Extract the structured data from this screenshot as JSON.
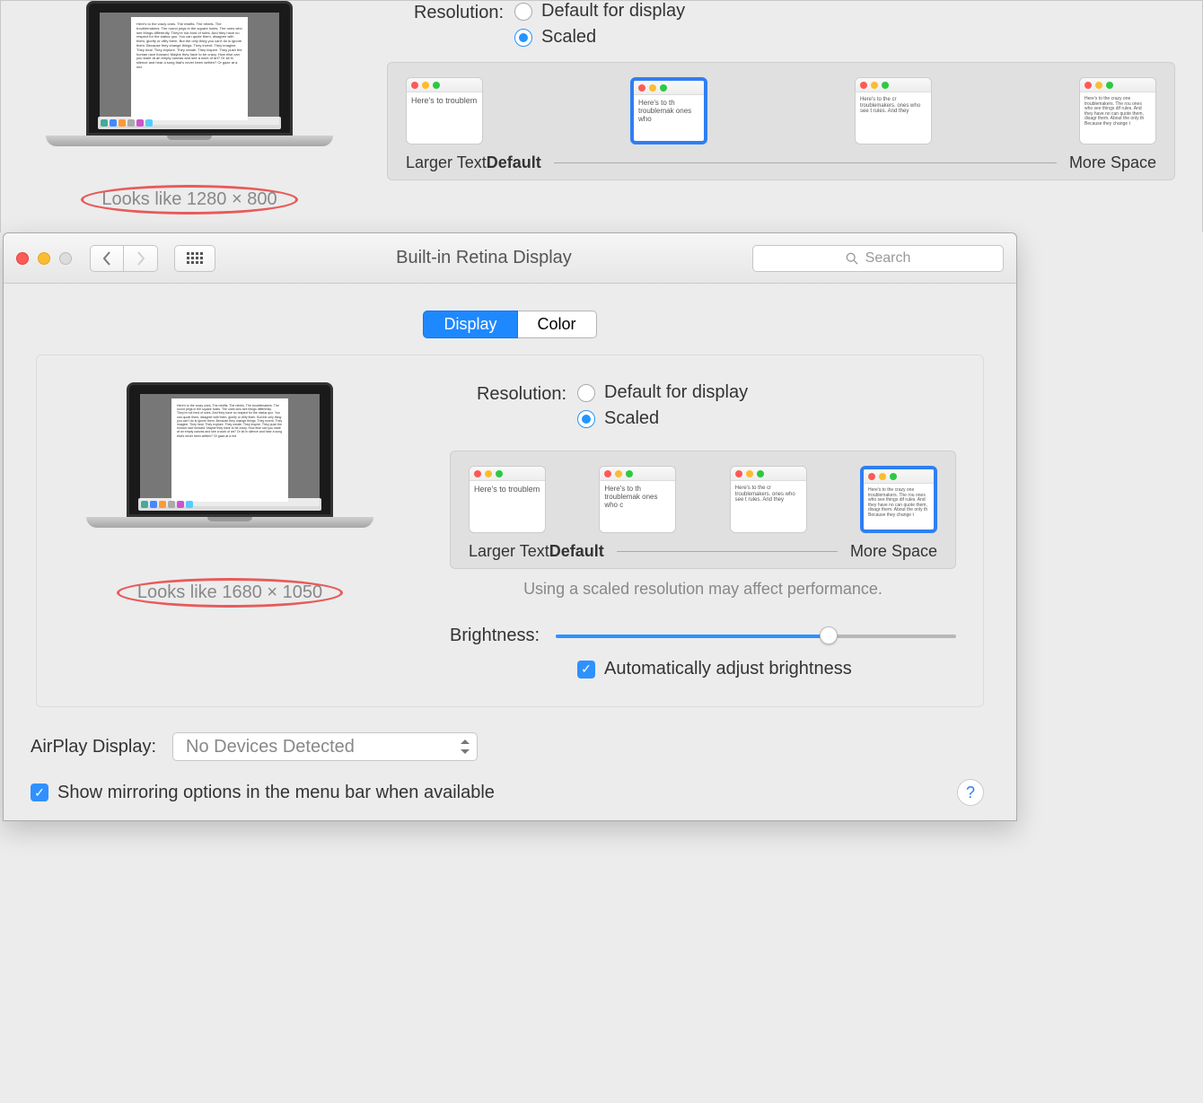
{
  "top": {
    "resolution_label": "Resolution:",
    "radio_default": "Default for display",
    "radio_scaled": "Scaled",
    "annotation": "Looks like 1280 × 800",
    "scale_labels": {
      "larger": "Larger Text",
      "default": "Default",
      "more": "More Space"
    },
    "sample_large": "Here's to troublem",
    "sample_default": "Here's to th troublemak ones who",
    "sample_mid": "Here's to the cr troublemakers. ones who see t rules. And they",
    "sample_small": "Here's to the crazy one troublemakers. The rou ones who see things dif rules. And they have no can quote them, disagr them. About the only th Because they change t"
  },
  "window": {
    "title": "Built-in Retina Display",
    "search_placeholder": "Search",
    "tabs": {
      "display": "Display",
      "color": "Color"
    },
    "resolution_label": "Resolution:",
    "radio_default": "Default for display",
    "radio_scaled": "Scaled",
    "annotation": "Looks like 1680 × 1050",
    "scale_labels": {
      "larger": "Larger Text",
      "default": "Default",
      "more": "More Space"
    },
    "sample_large": "Here's to troublem",
    "sample_default": "Here's to th troublemak ones who c",
    "sample_mid": "Here's to the cr troublemakers. ones who see t rules. And they",
    "sample_small": "Here's to the crazy one troublemakers. The rou ones who see things dif rules. And they have no can quote them, disagr them. About the only th Because they change t",
    "warning": "Using a scaled resolution may affect performance.",
    "brightness_label": "Brightness:",
    "auto_brightness": "Automatically adjust brightness",
    "airplay_label": "AirPlay Display:",
    "airplay_value": "No Devices Detected",
    "mirroring": "Show mirroring options in the menu bar when available"
  },
  "doc_text": "Here's to the crazy ones. The misfits. The rebels. The troublemakers. The round pegs in the square holes. The ones who see things differently. They're not fond of rules. And they have no respect for the status quo. You can quote them, disagree with them, glorify or vilify them. But the only thing you can't do is ignore them. Because they change things. They invent. They imagine. They heal. They explore. They create. They inspire. They push the human race forward. Maybe they have to be crazy. How else can you stare at an empty canvas and see a work of art? Or sit in silence and hear a song that's never been written? Or gaze at a red"
}
